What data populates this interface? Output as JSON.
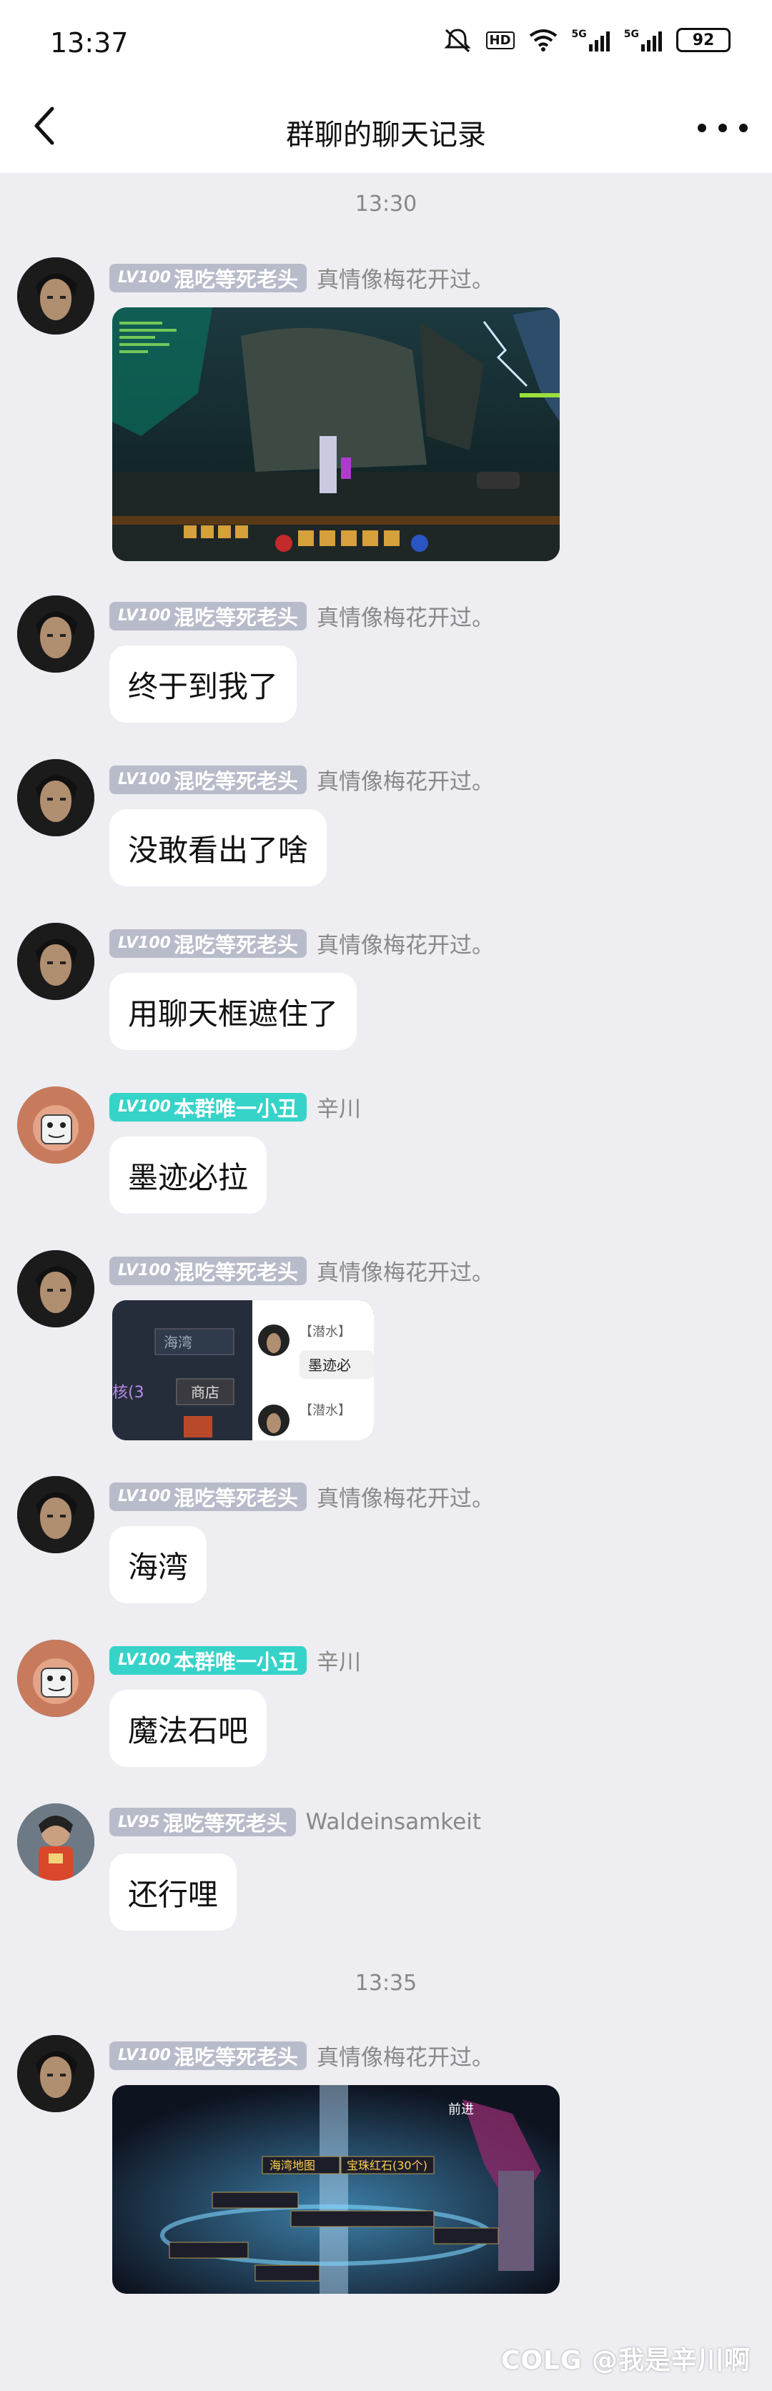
{
  "status_bar": {
    "time": "13:37",
    "network1": "5G",
    "network2": "5G",
    "hd": "HD",
    "battery": "92"
  },
  "nav": {
    "title": "群聊的聊天记录",
    "back_icon": "chevron-left-icon",
    "more_icon": "more-dots-icon"
  },
  "timestamps": [
    "13:30",
    "13:35"
  ],
  "messages": [
    {
      "level": "LV100",
      "badge": "混吃等死老头",
      "badge_color": "gray",
      "name": "真情像梅花开过。",
      "type": "image"
    },
    {
      "level": "LV100",
      "badge": "混吃等死老头",
      "badge_color": "gray",
      "name": "真情像梅花开过。",
      "type": "text",
      "text": "终于到我了"
    },
    {
      "level": "LV100",
      "badge": "混吃等死老头",
      "badge_color": "gray",
      "name": "真情像梅花开过。",
      "type": "text",
      "text": "没敢看出了啥"
    },
    {
      "level": "LV100",
      "badge": "混吃等死老头",
      "badge_color": "gray",
      "name": "真情像梅花开过。",
      "type": "text",
      "text": "用聊天框遮住了"
    },
    {
      "level": "LV100",
      "badge": "本群唯一小丑",
      "badge_color": "teal",
      "name": "辛川",
      "type": "text",
      "text": "墨迹必拉"
    },
    {
      "level": "LV100",
      "badge": "混吃等死老头",
      "badge_color": "gray",
      "name": "真情像梅花开过。",
      "type": "image",
      "img_texts": [
        "海湾",
        "商店",
        "核(3",
        "【潜水】",
        "墨迹必",
        "【潜水】"
      ]
    },
    {
      "level": "LV100",
      "badge": "混吃等死老头",
      "badge_color": "gray",
      "name": "真情像梅花开过。",
      "type": "text",
      "text": "海湾"
    },
    {
      "level": "LV100",
      "badge": "本群唯一小丑",
      "badge_color": "teal",
      "name": "辛川",
      "type": "text",
      "text": "魔法石吧"
    },
    {
      "level": "LV95",
      "badge": "混吃等死老头",
      "badge_color": "gray",
      "name": "Waldeinsamkeit",
      "type": "text",
      "text": "还行哩"
    },
    {
      "level": "LV100",
      "badge": "混吃等死老头",
      "badge_color": "gray",
      "name": "真情像梅花开过。",
      "type": "image",
      "img_texts": [
        "前进",
        "海湾地图",
        "宝珠红石(30个)"
      ]
    }
  ],
  "watermark": "COLG @我是辛川啊"
}
